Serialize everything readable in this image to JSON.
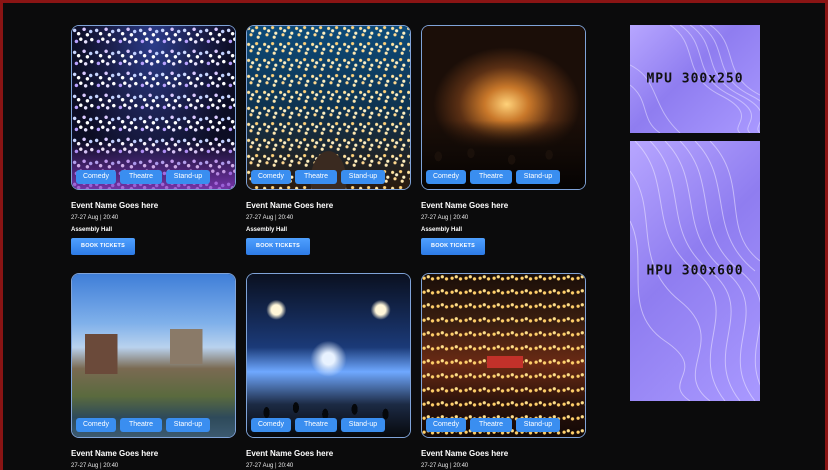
{
  "events": [
    {
      "name": "Event Name Goes here",
      "date": "27-27 Aug | 20:40",
      "venue": "Assembly Hall",
      "cta": "BOOK TICKETS",
      "tags": [
        "Comedy",
        "Theatre",
        "Stand-up"
      ],
      "image": "confetti-crowd-photo"
    },
    {
      "name": "Event Name Goes here",
      "date": "27-27 Aug | 20:40",
      "venue": "Assembly Hall",
      "cta": "BOOK TICKETS",
      "tags": [
        "Comedy",
        "Theatre",
        "Stand-up"
      ],
      "image": "fairy-light-trees-photo"
    },
    {
      "name": "Event Name Goes here",
      "date": "27-27 Aug | 20:40",
      "venue": "Assembly Hall",
      "cta": "BOOK TICKETS",
      "tags": [
        "Comedy",
        "Theatre",
        "Stand-up"
      ],
      "image": "concert-stage-photo"
    },
    {
      "name": "Event Name Goes here",
      "date": "27-27 Aug | 20:40",
      "tags": [
        "Comedy",
        "Theatre",
        "Stand-up"
      ],
      "image": "river-village-photo"
    },
    {
      "name": "Event Name Goes here",
      "date": "27-27 Aug | 20:40",
      "tags": [
        "Comedy",
        "Theatre",
        "Stand-up"
      ],
      "image": "stage-lights-crowd-photo"
    },
    {
      "name": "Event Name Goes here",
      "date": "27-27 Aug | 20:40",
      "tags": [
        "Comedy",
        "Theatre",
        "Stand-up"
      ],
      "image": "christmas-market-photo"
    }
  ],
  "ads": {
    "mpu": {
      "label": "MPU 300x250"
    },
    "hpu": {
      "label": "HPU 300x600"
    }
  },
  "colors": {
    "accent": "#3a8ef0",
    "frame": "#8a1414",
    "background": "#0b0b0c"
  }
}
